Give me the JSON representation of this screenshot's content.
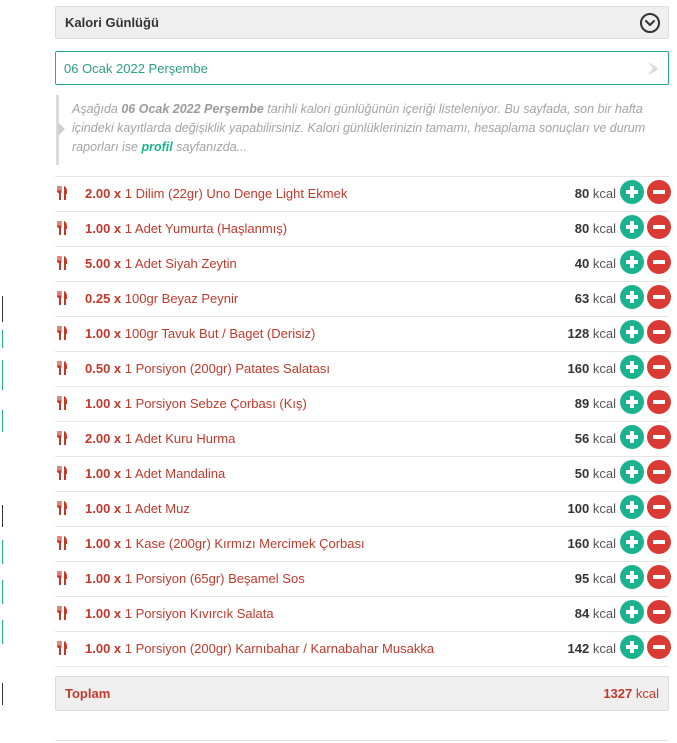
{
  "panel": {
    "title": "Kalori Günlüğü"
  },
  "date": {
    "value": "06 Ocak 2022 Perşembe"
  },
  "info": {
    "part1": "Aşağıda ",
    "date_bold": "06 Ocak 2022 Perşembe",
    "part2": " tarihli kalori günlüğünün içeriği listeleniyor. Bu sayfada, son bir hafta içindeki kayıtlarda değişiklik yapabilirsiniz. Kalori günlüklerinizin tamamı, hesaplama sonuçları ve durum raporları ise ",
    "link": "profil",
    "part3": " sayfanızda..."
  },
  "items": [
    {
      "qty": "2.00 x",
      "name": "1 Dilim (22gr) Uno Denge Light Ekmek",
      "kcal": "80"
    },
    {
      "qty": "1.00 x",
      "name": "1 Adet Yumurta (Haşlanmış)",
      "kcal": "80"
    },
    {
      "qty": "5.00 x",
      "name": "1 Adet Siyah Zeytin",
      "kcal": "40"
    },
    {
      "qty": "0.25 x",
      "name": "100gr Beyaz Peynir",
      "kcal": "63"
    },
    {
      "qty": "1.00 x",
      "name": "100gr Tavuk But / Baget (Derisiz)",
      "kcal": "128"
    },
    {
      "qty": "0.50 x",
      "name": "1 Porsiyon (200gr) Patates Salatası",
      "kcal": "160"
    },
    {
      "qty": "1.00 x",
      "name": "1 Porsiyon Sebze Çorbası (Kış)",
      "kcal": "89"
    },
    {
      "qty": "2.00 x",
      "name": "1 Adet Kuru Hurma",
      "kcal": "56"
    },
    {
      "qty": "1.00 x",
      "name": "1 Adet Mandalina",
      "kcal": "50"
    },
    {
      "qty": "1.00 x",
      "name": "1 Adet Muz",
      "kcal": "100"
    },
    {
      "qty": "1.00 x",
      "name": "1 Kase (200gr) Kırmızı Mercimek Çorbası",
      "kcal": "160"
    },
    {
      "qty": "1.00 x",
      "name": "1 Porsiyon (65gr) Beşamel Sos",
      "kcal": "95"
    },
    {
      "qty": "1.00 x",
      "name": "1 Porsiyon Kıvırcık Salata",
      "kcal": "84"
    },
    {
      "qty": "1.00 x",
      "name": "1 Porsiyon (200gr) Karnıbahar / Karnabahar Musakka",
      "kcal": "142"
    }
  ],
  "unit": "kcal",
  "total": {
    "label": "Toplam",
    "value": "1327"
  },
  "colors": {
    "accent": "#1bb38f",
    "danger": "#d93a34",
    "item_text": "#c0392b"
  }
}
